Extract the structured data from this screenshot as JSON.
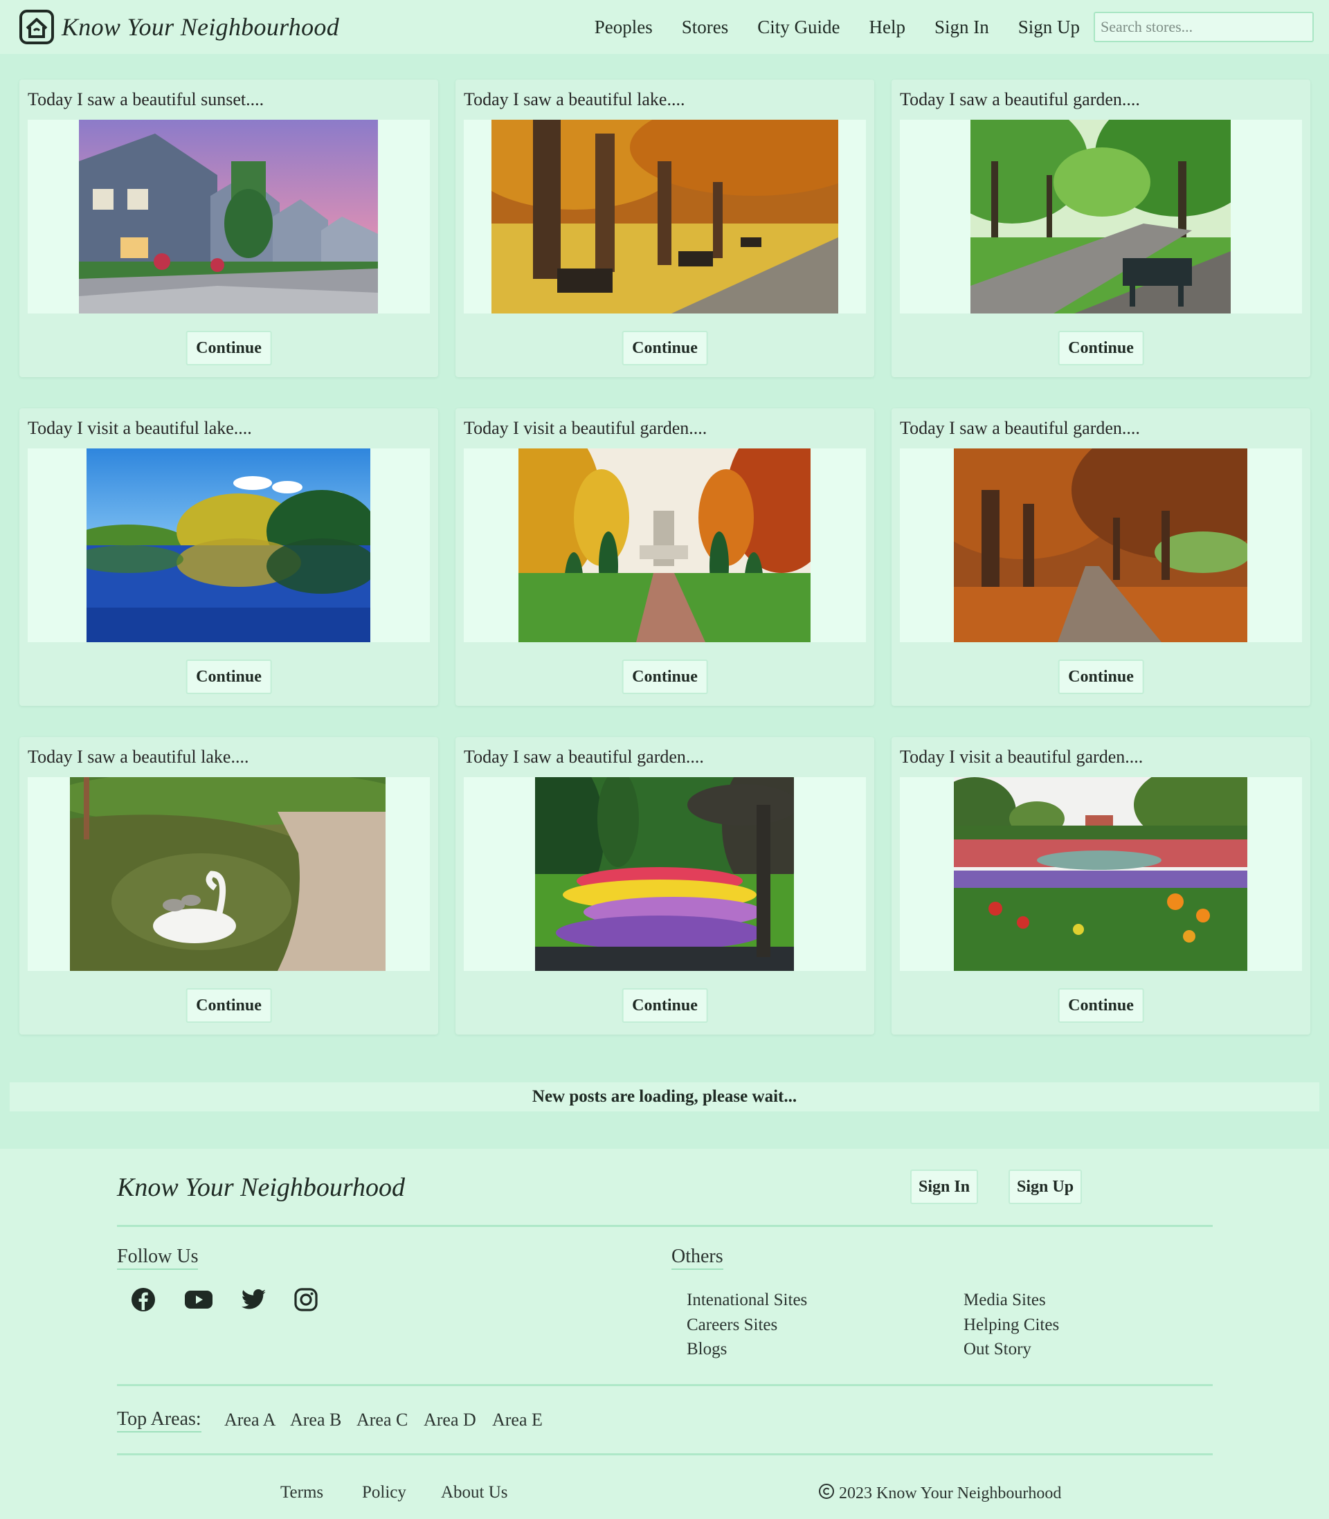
{
  "header": {
    "brand": "Know Your Neighbourhood",
    "nav": [
      "Peoples",
      "Stores",
      "City Guide",
      "Help",
      "Sign In",
      "Sign Up"
    ],
    "search_placeholder": "Search stores..."
  },
  "posts": [
    {
      "title": "Today I saw a beautiful sunset....",
      "button": "Continue",
      "image": "suburban-houses-sunset"
    },
    {
      "title": "Today I saw a beautiful lake....",
      "button": "Continue",
      "image": "autumn-park-benches"
    },
    {
      "title": "Today I saw a beautiful garden....",
      "button": "Continue",
      "image": "green-park-bench"
    },
    {
      "title": "Today I visit a beautiful lake....",
      "button": "Continue",
      "image": "lake-reflection"
    },
    {
      "title": "Today I visit a beautiful garden....",
      "button": "Continue",
      "image": "garden-fountain"
    },
    {
      "title": "Today I saw a beautiful garden....",
      "button": "Continue",
      "image": "autumn-path"
    },
    {
      "title": "Today I saw a beautiful lake....",
      "button": "Continue",
      "image": "swan-pond"
    },
    {
      "title": "Today I saw a beautiful garden....",
      "button": "Continue",
      "image": "flower-garden-fountain"
    },
    {
      "title": "Today I visit a beautiful garden....",
      "button": "Continue",
      "image": "flower-beds-garden"
    }
  ],
  "loading_text": "New posts are loading, please wait...",
  "footer": {
    "brand": "Know Your Neighbourhood",
    "sign_in": "Sign In",
    "sign_up": "Sign Up",
    "follow_heading": "Follow Us",
    "social_icons": [
      "facebook-icon",
      "youtube-icon",
      "twitter-icon",
      "instagram-icon"
    ],
    "others_heading": "Others",
    "others_col1": [
      "Intenational Sites",
      "Careers Sites",
      "Blogs"
    ],
    "others_col2": [
      "Media Sites",
      "Helping Cites",
      "Out Story"
    ],
    "top_areas_label": "Top Areas:",
    "areas": [
      "Area A",
      "Area B",
      "Area C",
      "Area D",
      "Area E"
    ],
    "bottom_links": [
      "Terms",
      "Policy",
      "About Us"
    ],
    "copyright": "2023 Know Your Neighbourhood"
  },
  "colors": {
    "page_bg": "#c9f2dc",
    "header_bg": "#d6f6e3",
    "card_bg": "#d4f4e2",
    "accent_border": "#aee8c8"
  }
}
